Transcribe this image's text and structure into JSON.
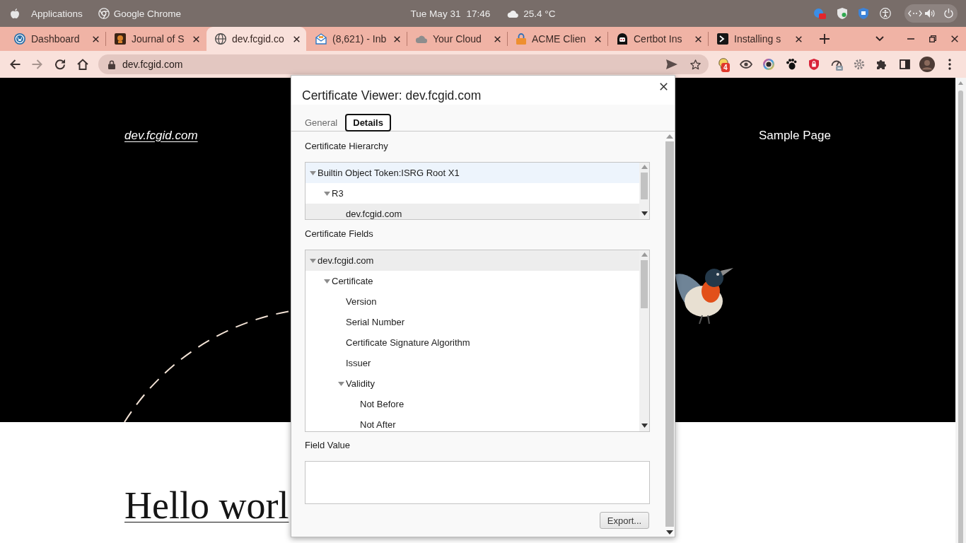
{
  "top_bar": {
    "activities": "Applications",
    "app_menu": "Google Chrome",
    "date": "Tue May 31",
    "time": "17:46",
    "weather": "25.4 °C"
  },
  "tabs": [
    {
      "kind": "disc",
      "title": "Dashboard",
      "selected": false
    },
    {
      "kind": "portrait",
      "title": "Journal of S",
      "selected": false
    },
    {
      "kind": "globe",
      "title": "dev.fcgid.co",
      "selected": true
    },
    {
      "kind": "envelope",
      "title": "(8,621) - Inb",
      "selected": false
    },
    {
      "kind": "cloud",
      "title": "Your Cloud",
      "selected": false
    },
    {
      "kind": "lock",
      "title": "ACME Clien",
      "selected": false
    },
    {
      "kind": "robot",
      "title": "Certbot Ins",
      "selected": false
    },
    {
      "kind": "prompt",
      "title": "Installing s",
      "selected": false
    }
  ],
  "toolbar": {
    "nav_buttons": [
      {
        "kind": "back",
        "disabled": false
      },
      {
        "kind": "forward",
        "disabled": true
      },
      {
        "kind": "reload",
        "disabled": false
      },
      {
        "kind": "home",
        "disabled": false
      }
    ],
    "address": "dev.fcgid.com",
    "extension_badge": "4"
  },
  "page": {
    "site_title": "dev.fcgid.com",
    "nav": [
      "Sample Page"
    ],
    "post_title": "Hello worl"
  },
  "dialog": {
    "title": "Certificate Viewer: dev.fcgid.com",
    "tabs": [
      {
        "label": "General",
        "selected": false
      },
      {
        "label": "Details",
        "selected": true
      }
    ],
    "hierarchy": {
      "label": "Certificate Hierarchy",
      "items": [
        {
          "label": "Builtin Object Token:ISRG Root X1",
          "expanded": true,
          "hovered": true,
          "selected": false,
          "children": [
            {
              "label": "R3",
              "expanded": true,
              "hovered": false,
              "selected": false,
              "children": [
                {
                  "label": "dev.fcgid.com",
                  "hovered": false,
                  "selected": true
                }
              ]
            }
          ]
        }
      ]
    },
    "fields": {
      "label": "Certificate Fields",
      "items": [
        {
          "label": "dev.fcgid.com",
          "expanded": true,
          "selected": true,
          "children": [
            {
              "label": "Certificate",
              "expanded": true,
              "selected": false,
              "children": [
                {
                  "label": "Version",
                  "selected": false
                },
                {
                  "label": "Serial Number",
                  "selected": false
                },
                {
                  "label": "Certificate Signature Algorithm",
                  "selected": false
                },
                {
                  "label": "Issuer",
                  "selected": false
                },
                {
                  "label": "Validity",
                  "expanded": true,
                  "selected": false,
                  "children": [
                    {
                      "label": "Not Before",
                      "selected": false
                    },
                    {
                      "label": "Not After",
                      "selected": false
                    }
                  ]
                }
              ]
            }
          ]
        }
      ]
    },
    "field_value": {
      "label": "Field Value"
    },
    "export_button": "Export..."
  }
}
